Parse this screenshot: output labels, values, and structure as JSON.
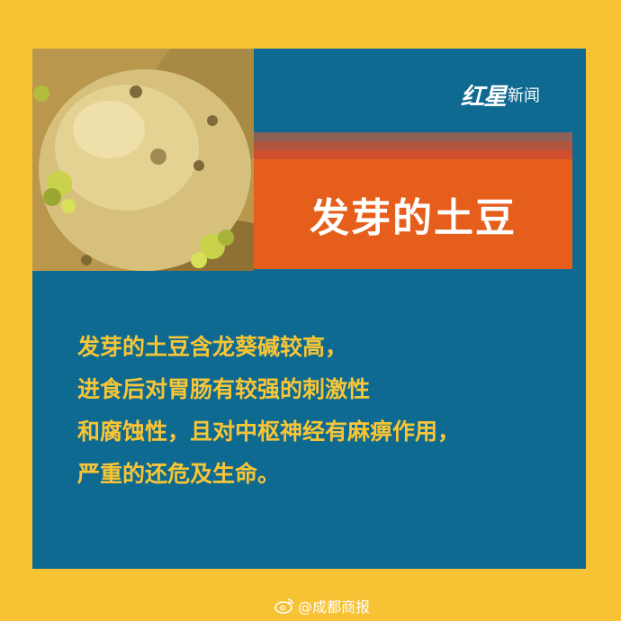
{
  "brand": {
    "logo_main": "红星",
    "logo_sub": "新闻"
  },
  "title": "发芽的土豆",
  "body_lines": [
    "发芽的土豆含龙葵碱较高，",
    "进食后对胃肠有较强的刺激性",
    "和腐蚀性，且对中枢神经有麻痹作用，",
    "严重的还危及生命。"
  ],
  "footer": {
    "source": "@成都商报"
  },
  "colors": {
    "background": "#f7c234",
    "panel": "#0e6a90",
    "title_box": "#e65e1c",
    "body_text": "#f8c536"
  },
  "icons": {
    "footer": "weibo-icon"
  }
}
